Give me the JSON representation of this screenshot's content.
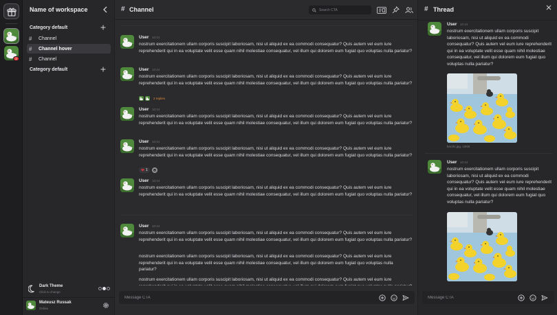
{
  "workspace": {
    "name": "Name of workspace",
    "rail_badge": "2"
  },
  "sidebar": {
    "categories": [
      {
        "label": "Category default",
        "channels": [
          {
            "label": "Channel",
            "state": "normal"
          },
          {
            "label": "Channel hover",
            "state": "hover"
          },
          {
            "label": "Channel",
            "state": "normal"
          }
        ]
      },
      {
        "label": "Category default",
        "channels": []
      }
    ],
    "theme": {
      "title": "Dark Theme",
      "subtitle": "Click to change"
    },
    "user": {
      "name": "Mateusz Russak",
      "status": "Online"
    }
  },
  "channel": {
    "title": "Channel",
    "search_placeholder": "Search CTA",
    "composer_placeholder": "Message CTA",
    "messages": [
      {
        "name": "User",
        "time": "10:44",
        "text": "nostrum exercitationem ullam corporis suscipit laboriosam, nisi ut aliquid ex ea commodi consequatur? Quis autem vel eum iure reprehenderit qui in ea voluptate velit esse quam nihil molestiae consequatur, vel illum qui dolorem eum fugiat quo voluptas nulla pariatur?"
      },
      {
        "name": "User",
        "time": "10:44",
        "text": "nostrum exercitationem ullam corporis suscipit laboriosam, nisi ut aliquid ex ea commodi consequatur? Quis autem vel eum iure reprehenderit qui in ea voluptate velit esse quam nihil molestiae consequatur, vel illum qui dolorem eum fugiat quo voluptas nulla pariatur?",
        "replies": "2 replies"
      },
      {
        "name": "User",
        "time": "10:44",
        "text": "nostrum exercitationem ullam corporis suscipit laboriosam, nisi ut aliquid ex ea commodi consequatur? Quis autem vel eum iure reprehenderit qui in ea voluptate velit esse quam nihil molestiae consequatur, vel illum qui dolorem eum fugiat quo voluptas nulla pariatur?"
      },
      {
        "name": "User",
        "time": "10:44",
        "text": "nostrum exercitationem ullam corporis suscipit laboriosam, nisi ut aliquid ex ea commodi consequatur? Quis autem vel eum iure reprehenderit qui in ea voluptate velit esse quam nihil molestiae consequatur, vel illum qui dolorem eum fugiat quo voluptas nulla pariatur?",
        "reaction": {
          "emoji": "heart",
          "count": "1"
        }
      },
      {
        "name": "User",
        "time": "10:44",
        "text": "nostrum exercitationem ullam corporis suscipit laboriosam, nisi ut aliquid ex ea commodi consequatur? Quis autem vel eum iure reprehenderit qui in ea voluptate velit esse quam nihil molestiae consequatur, vel illum qui dolorem eum fugiat quo voluptas nulla pariatur?"
      },
      {
        "name": "User",
        "time": "10:44",
        "text": "nostrum exercitationem ullam corporis suscipit laboriosam, nisi ut aliquid ex ea commodi consequatur? Quis autem vel eum iure reprehenderit qui in ea voluptate velit esse quam nihil molestiae consequatur, vel illum qui dolorem eum fugiat quo voluptas nulla pariatur?",
        "text2": "nostrum exercitationem ullam corporis suscipit laboriosam, nisi ut aliquid ex ea commodi consequatur? Quis autem vel eum iure reprehenderit qui in ea voluptate velit esse quam nihil molestiae consequatur, vel illum qui dolorem eum fugiat quo voluptas nulla pariatur?",
        "text3": "nostrum exercitationem ullam corporis suscipit laboriosam, nisi ut aliquid ex ea commodi consequatur? Quis autem vel eum iure reprehenderit qui in ea voluptate velit esse quam nihil molestiae consequatur, vel illum qui dolorem eum fugiat quo voluptas nulla pariatur?"
      }
    ]
  },
  "thread": {
    "title": "Thread",
    "composer_placeholder": "Message CTA",
    "messages": [
      {
        "name": "User",
        "time": "10:44",
        "text": "nostrum exercitationem ullam corporis suscipit laboriosam, nisi ut aliquid ex ea commodi consequatur? Quis autem vel eum iure reprehenderit qui in ea voluptate velit esse quam nihil molestiae consequatur, vel illum qui dolorem eum fugiat quo voluptas nulla pariatur?",
        "file": "kaczki.jpg, 12KB"
      },
      {
        "name": "User",
        "time": "10:44",
        "text": "nostrum exercitationem ullam corporis suscipit laboriosam, nisi ut aliquid ex ea commodi consequatur? Quis autem vel eum iure reprehenderit qui in ea voluptate velit esse quam nihil molestiae consequatur, vel illum qui dolorem eum fugiat quo voluptas nulla pariatur?"
      }
    ]
  },
  "colors": {
    "background": "#2b2b2e",
    "sidebar": "#27272a",
    "rail": "#1e1e21",
    "accent_replies": "#e08a3a",
    "badge": "#e03a3a"
  },
  "icons": {
    "logo": "gift-box-icon",
    "search": "search-icon",
    "files": "image-gallery-icon",
    "pin": "pin-icon",
    "members": "users-icon",
    "attach": "plus-circle-icon",
    "emoji": "smile-icon",
    "send": "send-icon",
    "settings": "gear-icon",
    "theme": "moon-icon"
  }
}
